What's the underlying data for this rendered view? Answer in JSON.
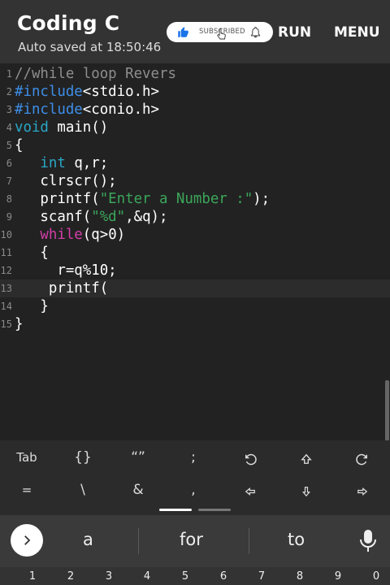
{
  "header": {
    "title": "Coding C",
    "autosave": "Auto saved at 18:50:46",
    "subscribe_label": "SUBSCRIBED",
    "run_label": "RUN",
    "menu_label": "MENU"
  },
  "editor": {
    "lines": [
      {
        "num": "1",
        "text": "//while loop Revers"
      },
      {
        "num": "2",
        "pre": "#include",
        "rest": "<stdio.h>"
      },
      {
        "num": "3",
        "pre": "#include",
        "rest": "<conio.h>"
      },
      {
        "num": "4",
        "type": "void",
        "rest": " main()"
      },
      {
        "num": "5",
        "text": "{"
      },
      {
        "num": "6",
        "indent": "   ",
        "type": "int",
        "rest": " q,r;"
      },
      {
        "num": "7",
        "text": "   clrscr();"
      },
      {
        "num": "8",
        "pre_text": "   printf(",
        "str": "\"Enter a Number :\"",
        "post": ");"
      },
      {
        "num": "9",
        "pre_text": "   scanf(",
        "str": "\"%d\"",
        "post": ",&q);"
      },
      {
        "num": "10",
        "indent": "   ",
        "kw": "while",
        "rest": "(q>0)"
      },
      {
        "num": "11",
        "text": "   {"
      },
      {
        "num": "12",
        "text": "     r=q%10;"
      },
      {
        "num": "13",
        "text": "    printf("
      },
      {
        "num": "14",
        "text": "   }"
      },
      {
        "num": "15",
        "text": "}"
      }
    ]
  },
  "extra_keys": {
    "row1": [
      "Tab",
      "{}",
      "“”",
      ";",
      "undo",
      "shift",
      "redo"
    ],
    "row2": [
      "=",
      "\\",
      "&",
      ",",
      "left",
      "down",
      "right"
    ]
  },
  "suggestions": [
    "a",
    "for",
    "to"
  ],
  "number_row": [
    "1",
    "2",
    "3",
    "4",
    "5",
    "6",
    "7",
    "8",
    "9",
    "0"
  ],
  "icons": {
    "subscribe": "thumbs-up-icon",
    "bell": "bell-icon",
    "expand": "chevron-right-icon",
    "mic": "microphone-icon"
  },
  "colors": {
    "background": "#222222",
    "toolbar": "#333333",
    "comment": "#8e8e8e",
    "preprocessor": "#3d8ee8",
    "type": "#2aa7c6",
    "string": "#3ba65a",
    "keyword": "#d23fa8"
  }
}
